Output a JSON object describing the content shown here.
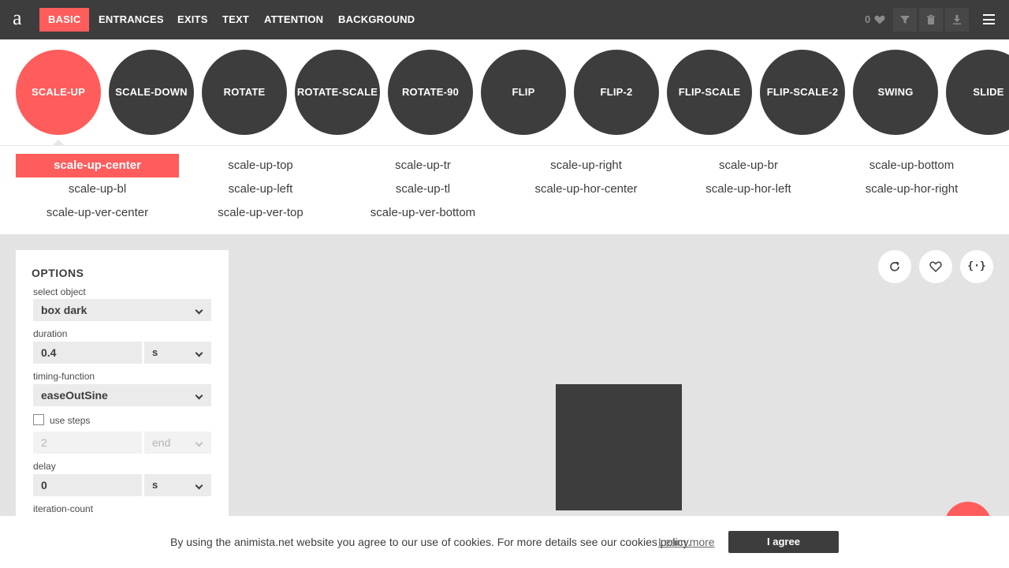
{
  "nav": {
    "logo": "a",
    "items": [
      "BASIC",
      "ENTRANCES",
      "EXITS",
      "TEXT",
      "ATTENTION",
      "BACKGROUND"
    ],
    "active": "BASIC",
    "fav_count": "0"
  },
  "animations": [
    "SCALE-UP",
    "SCALE-DOWN",
    "ROTATE",
    "ROTATE-SCALE",
    "ROTATE-90",
    "FLIP",
    "FLIP-2",
    "FLIP-SCALE",
    "FLIP-SCALE-2",
    "SWING",
    "SLIDE"
  ],
  "variants": [
    "scale-up-center",
    "scale-up-top",
    "scale-up-tr",
    "scale-up-right",
    "scale-up-br",
    "scale-up-bottom",
    "scale-up-bl",
    "scale-up-left",
    "scale-up-tl",
    "scale-up-hor-center",
    "scale-up-hor-left",
    "scale-up-hor-right",
    "scale-up-ver-center",
    "scale-up-ver-top",
    "scale-up-ver-bottom"
  ],
  "options": {
    "title": "OPTIONS",
    "select_object_label": "select object",
    "select_object_value": "box dark",
    "duration_label": "duration",
    "duration_value": "0.4",
    "duration_unit": "s",
    "timing_label": "timing-function",
    "timing_value": "easeOutSine",
    "use_steps_label": "use steps",
    "steps_value": "2",
    "steps_pos": "end",
    "delay_label": "delay",
    "delay_value": "0",
    "delay_unit": "s",
    "iteration_label": "iteration-count"
  },
  "cookie": {
    "text": "By using the animista.net website you agree to our use of cookies. For more details see our cookies policy.",
    "link": "Learn more",
    "button": "I agree"
  },
  "colors": {
    "accent": "#ff5c5c",
    "dark": "#3d3d3d",
    "stage": "#e3e3e3"
  }
}
